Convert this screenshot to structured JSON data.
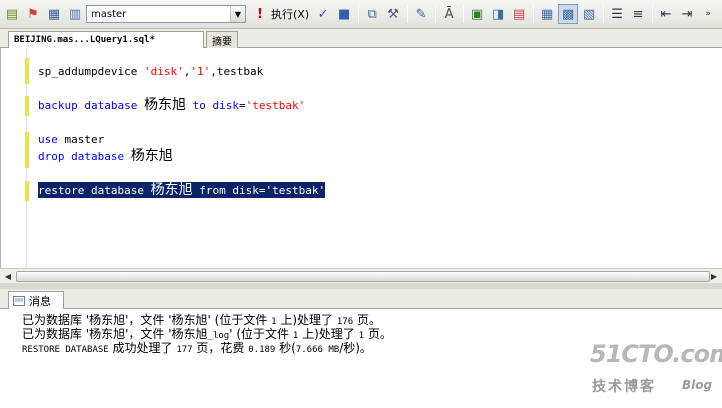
{
  "toolbar": {
    "database": "master",
    "execute_label": "执行(X)"
  },
  "tabs": {
    "query": "BEIJING.mas...LQuery1.sql*",
    "summary": "摘要"
  },
  "editor": {
    "line1": {
      "proc": "sp_addumpdevice",
      "arg1": "'disk'",
      "comma1": ",",
      "arg2": "'1'",
      "rest": ",testbak"
    },
    "line2": {
      "kw1": "backup",
      "kw2": "database",
      "db": "杨东旭",
      "kw3": "to",
      "kw4": "disk",
      "eq": "=",
      "val": "'testbak'"
    },
    "line3": {
      "kw": "use",
      "name": "master"
    },
    "line4": {
      "kw1": "drop",
      "kw2": "database",
      "db": "杨东旭"
    },
    "line5": {
      "kw1": "restore",
      "kw2": "database",
      "db": "杨东旭",
      "kw3": "from",
      "kw4": "disk",
      "eq": "=",
      "val": "'testbak'"
    }
  },
  "messages_tab": "消息",
  "messages": {
    "m1_pre": "已为数据库 '杨东旭'，文件 '杨东旭' (位于文件 ",
    "m1_num1": "1",
    "m1_mid": " 上)处理了 ",
    "m1_num2": "176",
    "m1_post": " 页。",
    "m2_pre": "已为数据库 '杨东旭'，文件 '杨东旭",
    "m2_log": "_log",
    "m2_mid": "' (位于文件 ",
    "m2_num1": "1",
    "m2_mid2": " 上)处理了 ",
    "m2_num2": "1",
    "m2_post": " 页。",
    "m3_a": "RESTORE DATABASE",
    "m3_b": " 成功处理了 ",
    "m3_num1": "177",
    "m3_c": " 页，花费 ",
    "m3_num2": "0.189",
    "m3_d": " 秒(",
    "m3_num3": "7.666 MB",
    "m3_e": "/秒)。"
  },
  "watermark": {
    "site": "51CTO.com",
    "sub": "技术博客",
    "blog": "Blog"
  }
}
